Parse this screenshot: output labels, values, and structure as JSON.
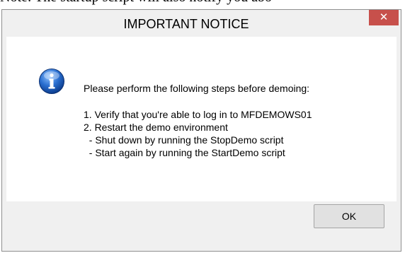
{
  "document": {
    "note_text": "Note: The startup script will also notify you abo"
  },
  "dialog": {
    "title": "IMPORTANT NOTICE",
    "close_label": "✕",
    "icon": "info-icon",
    "message": {
      "intro": "Please perform the following steps before demoing:",
      "steps": [
        "1. Verify that you're able to log in to MFDEMOWS01",
        "2. Restart the demo environment",
        "  - Shut down by running the StopDemo script",
        "  - Start again by running the StartDemo script"
      ]
    },
    "ok_label": "OK"
  },
  "colors": {
    "close_button": "#c7504b",
    "window_border": "#8f8f8f",
    "window_background": "#f0f0f0",
    "icon_blue": "#2a6fd0"
  }
}
